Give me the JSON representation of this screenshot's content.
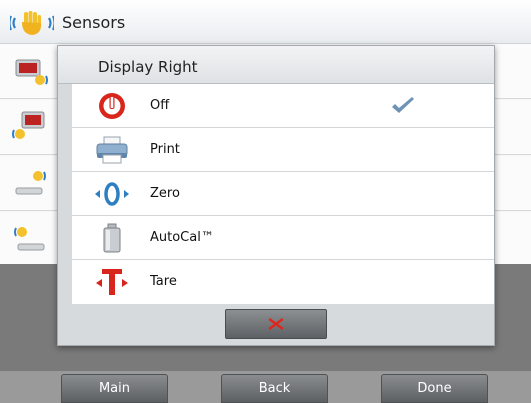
{
  "header": {
    "title": "Sensors",
    "icon": "sensor-hand-icon"
  },
  "background_rows": [
    {
      "icon": "display-sensor-icon"
    },
    {
      "icon": "display-sensor-icon"
    },
    {
      "icon": "pan-sensor-icon"
    },
    {
      "icon": "pan-sensor-icon"
    }
  ],
  "dialog": {
    "title": "Display Right",
    "options": [
      {
        "label": "Off",
        "icon": "off-icon",
        "selected": true
      },
      {
        "label": "Print",
        "icon": "printer-icon",
        "selected": false
      },
      {
        "label": "Zero",
        "icon": "zero-icon",
        "selected": false
      },
      {
        "label": "AutoCal™",
        "icon": "calibration-weight-icon",
        "selected": false
      },
      {
        "label": "Tare",
        "icon": "tare-icon",
        "selected": false
      }
    ],
    "close_icon": "red-x-icon"
  },
  "footer": {
    "main_label": "Main",
    "back_label": "Back",
    "done_label": "Done"
  },
  "colors": {
    "accent_red": "#d8261c",
    "accent_blue": "#2d7fc1",
    "check_blue": "#6f93b6"
  }
}
